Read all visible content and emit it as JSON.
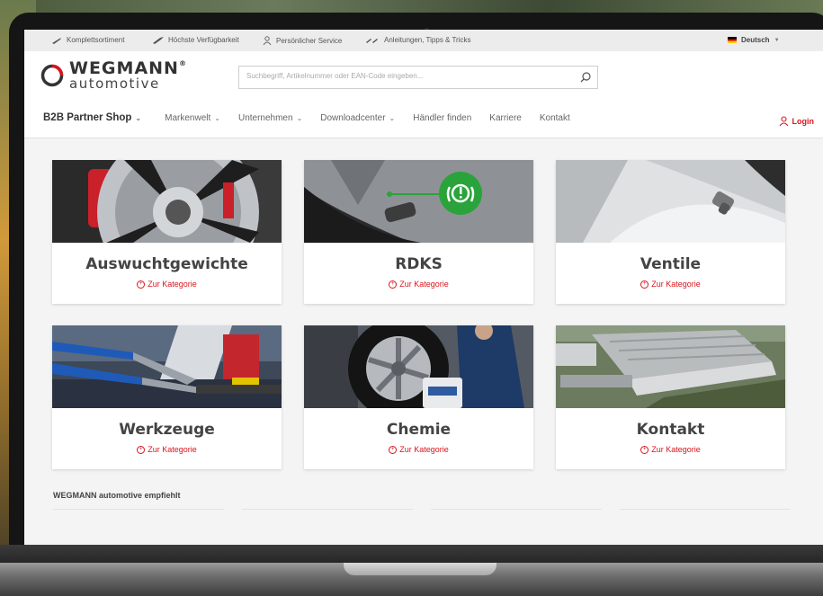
{
  "topbar": {
    "items": [
      {
        "label": "Komplettsortiment",
        "icon": "wrench-icon"
      },
      {
        "label": "Höchste Verfügbarkeit",
        "icon": "tool-icon"
      },
      {
        "label": "Persönlicher Service",
        "icon": "person-icon"
      },
      {
        "label": "Anleitungen, Tipps & Tricks",
        "icon": "tools-icon"
      }
    ],
    "language": "Deutsch"
  },
  "logo": {
    "main": "WEGMANN",
    "sub": "automotive",
    "mark": "®"
  },
  "search": {
    "placeholder": "Suchbegriff, Artikelnummer oder EAN-Code eingeben..."
  },
  "nav": {
    "items": [
      {
        "label": "B2B Partner Shop",
        "dropdown": true
      },
      {
        "label": "Markenwelt",
        "dropdown": true
      },
      {
        "label": "Unternehmen",
        "dropdown": true
      },
      {
        "label": "Downloadcenter",
        "dropdown": true
      },
      {
        "label": "Händler finden",
        "dropdown": false
      },
      {
        "label": "Karriere",
        "dropdown": false
      },
      {
        "label": "Kontakt",
        "dropdown": false
      }
    ],
    "login": "Login"
  },
  "categories": [
    {
      "title": "Auswuchtgewichte",
      "link": "Zur Kategorie"
    },
    {
      "title": "RDKS",
      "link": "Zur Kategorie"
    },
    {
      "title": "Ventile",
      "link": "Zur Kategorie"
    },
    {
      "title": "Werkzeuge",
      "link": "Zur Kategorie"
    },
    {
      "title": "Chemie",
      "link": "Zur Kategorie"
    },
    {
      "title": "Kontakt",
      "link": "Zur Kategorie"
    }
  ],
  "recommend": {
    "title": "WEGMANN automotive empfiehlt"
  },
  "colors": {
    "accent": "#d9141c",
    "tpms_green": "#2aa33a"
  }
}
